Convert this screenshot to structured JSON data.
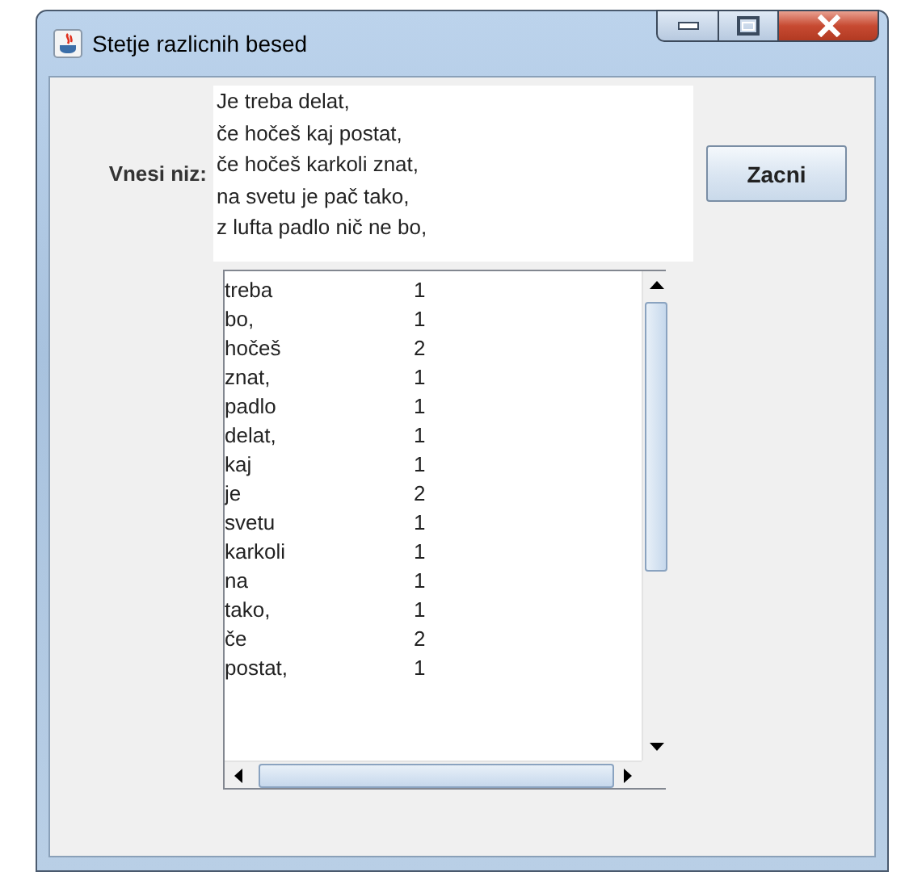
{
  "window": {
    "title": "Stetje razlicnih besed"
  },
  "input": {
    "label": "Vnesi niz:",
    "value": "Je treba delat,\nče hočeš kaj postat,\nče hočeš karkoli znat,\nna svetu je pač tako,\nz lufta padlo nič ne bo,"
  },
  "button": {
    "label": "Zacni"
  },
  "list": {
    "rows": [
      {
        "word": "treba",
        "count": "1"
      },
      {
        "word": "bo,",
        "count": "1"
      },
      {
        "word": "hočeš",
        "count": "2"
      },
      {
        "word": "znat,",
        "count": "1"
      },
      {
        "word": "padlo",
        "count": "1"
      },
      {
        "word": "delat,",
        "count": "1"
      },
      {
        "word": "kaj",
        "count": "1"
      },
      {
        "word": "je",
        "count": "2"
      },
      {
        "word": "svetu",
        "count": "1"
      },
      {
        "word": "karkoli",
        "count": "1"
      },
      {
        "word": "na",
        "count": "1"
      },
      {
        "word": "tako,",
        "count": "1"
      },
      {
        "word": "če",
        "count": "2"
      },
      {
        "word": "postat,",
        "count": "1"
      }
    ]
  }
}
